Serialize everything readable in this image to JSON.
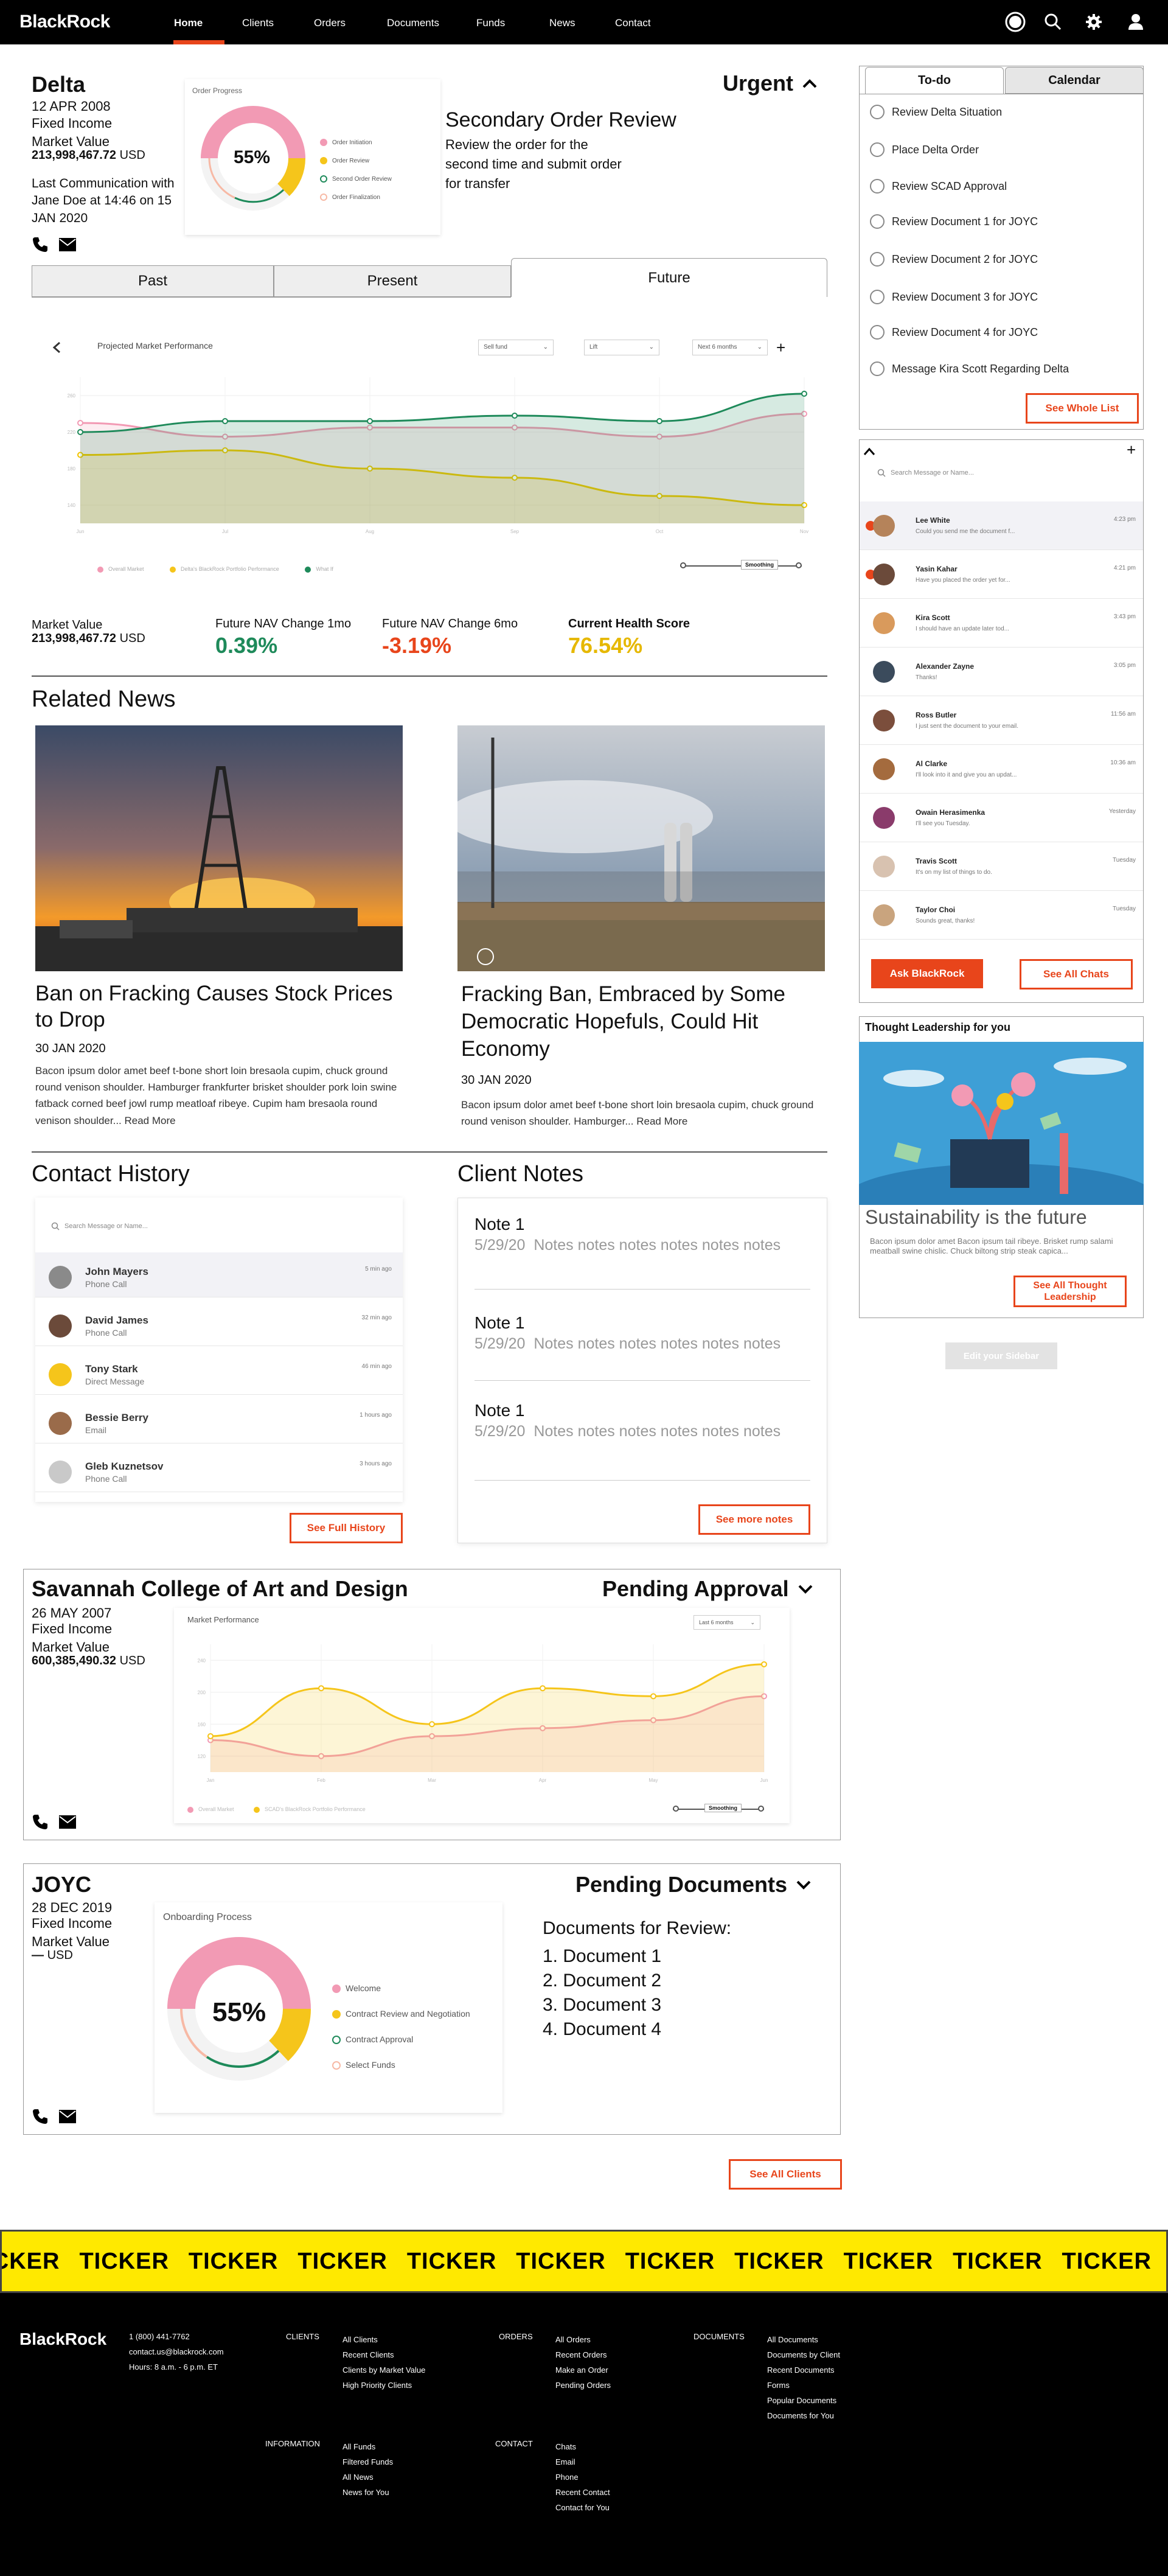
{
  "nav": {
    "logo": "BlackRock",
    "links": [
      "Home",
      "Clients",
      "Orders",
      "Documents",
      "Funds",
      "News",
      "Contact"
    ],
    "active": "Home",
    "icons": [
      "profile-ring-icon",
      "search-icon",
      "gear-icon",
      "user-icon"
    ]
  },
  "delta": {
    "name": "Delta",
    "date": "12 APR 2008",
    "type": "Fixed Income",
    "mv_label": "Market Value",
    "mv": "213,998,467.72",
    "currency": "USD",
    "last_comm": "Last Communication with Jane Doe at 14:46 on 15 JAN 2020",
    "priority": "Urgent",
    "progress_title": "Order Progress",
    "progress_pct": "55%",
    "progress_value": 0.55,
    "progress_legend": [
      "Order Initiation",
      "Order Review",
      "Second Order Review",
      "Order Finalization"
    ],
    "review_title": "Secondary Order Review",
    "review_text": "Review the order for the second time and submit order for transfer",
    "tabs": [
      "Past",
      "Present",
      "Future"
    ],
    "active_tab": "Future",
    "chart_title": "Projected Market Performance",
    "selects": [
      "Sell fund",
      "Lift",
      "Next 6 months"
    ],
    "smoothing": "Smoothing",
    "stats": {
      "mv_label": "Market Value",
      "mv": "213,998,467.72",
      "currency": "USD",
      "c1_label": "Future NAV Change 1mo",
      "c1": "0.39%",
      "c2_label": "Future NAV Change 6mo",
      "c2": "-3.19%",
      "c3_label": "Current Health Score",
      "c3": "76.54%"
    }
  },
  "todo": {
    "tabs": [
      "To-do",
      "Calendar"
    ],
    "items": [
      "Review Delta Situation",
      "Place Delta Order",
      "Review SCAD Approval",
      "Review Document 1 for JOYC",
      "Review Document 2 for JOYC",
      "Review Document 3 for JOYC",
      "Review Document 4 for JOYC",
      "Message Kira Scott Regarding Delta"
    ],
    "button": "See Whole List"
  },
  "chats": {
    "search_placeholder": "Search Message or Name...",
    "items": [
      {
        "name": "Lee White",
        "preview": "Could you send me the document f...",
        "time": "4:23 pm"
      },
      {
        "name": "Yasin Kahar",
        "preview": "Have you placed the order yet for...",
        "time": "4:21 pm"
      },
      {
        "name": "Kira Scott",
        "preview": "I should have an update later tod...",
        "time": "3:43 pm"
      },
      {
        "name": "Alexander Zayne",
        "preview": "Thanks!",
        "time": "3:05 pm"
      },
      {
        "name": "Ross Butler",
        "preview": "I just sent the document to your email.",
        "time": "11:56 am"
      },
      {
        "name": "Al Clarke",
        "preview": "I'll look into it and give you an updat...",
        "time": "10:36 am"
      },
      {
        "name": "Owain Herasimenka",
        "preview": "I'll see you Tuesday.",
        "time": "Yesterday"
      },
      {
        "name": "Travis Scott",
        "preview": "It's on my list of things to do.",
        "time": "Tuesday"
      },
      {
        "name": "Taylor Choi",
        "preview": "Sounds great, thanks!",
        "time": "Tuesday"
      }
    ],
    "ask_button": "Ask BlackRock",
    "see_all_button": "See All Chats"
  },
  "thought": {
    "header": "Thought Leadership for you",
    "title": "Sustainability is the future",
    "text": "Bacon ipsum dolor amet Bacon ipsum tail ribeye. Brisket rump salami meatball swine chislic. Chuck biltong strip steak capica...",
    "button": "See All Thought Leadership",
    "edit_button": "Edit your Sidebar"
  },
  "news": {
    "title": "Related News",
    "items": [
      {
        "headline": "Ban on Fracking Causes Stock Prices to Drop",
        "date": "30 JAN 2020",
        "body": "Bacon ipsum dolor amet beef t-bone short loin bresaola cupim, chuck ground round venison shoulder. Hamburger frankfurter brisket shoulder pork loin swine fatback corned beef jowl rump meatloaf ribeye. Cupim ham bresaola round venison shoulder... Read More"
      },
      {
        "headline": "Fracking Ban, Embraced by Some Democratic Hopefuls, Could Hit Economy",
        "date": "30 JAN 2020",
        "body": "Bacon ipsum dolor amet beef t-bone short loin bresaola cupim, chuck ground round venison shoulder. Hamburger... Read More"
      }
    ]
  },
  "contact_history": {
    "title": "Contact History",
    "search_placeholder": "Search Message or Name...",
    "items": [
      {
        "name": "John Mayers",
        "type": "Phone Call",
        "time": "5 min ago"
      },
      {
        "name": "David James",
        "type": "Phone Call",
        "time": "32 min ago"
      },
      {
        "name": "Tony Stark",
        "type": "Direct Message",
        "time": "46 min ago"
      },
      {
        "name": "Bessie Berry",
        "type": "Email",
        "time": "1 hours ago"
      },
      {
        "name": "Gleb Kuznetsov",
        "type": "Phone Call",
        "time": "3 hours ago"
      }
    ],
    "button": "See Full History"
  },
  "client_notes": {
    "title": "Client Notes",
    "items": [
      {
        "title": "Note 1",
        "date": "5/29/20",
        "text": "Notes notes notes notes notes notes"
      },
      {
        "title": "Note 1",
        "date": "5/29/20",
        "text": "Notes notes notes notes notes notes"
      },
      {
        "title": "Note 1",
        "date": "5/29/20",
        "text": "Notes notes notes notes notes notes"
      }
    ],
    "button": "See more notes"
  },
  "scad": {
    "name": "Savannah College of Art and Design",
    "status": "Pending Approval",
    "date": "26 MAY 2007",
    "type": "Fixed Income",
    "mv_label": "Market Value",
    "mv": "600,385,490.32",
    "currency": "USD",
    "chart_title": "Market Performance",
    "select": "Last 6 months",
    "smoothing": "Smoothing"
  },
  "joyc": {
    "name": "JOYC",
    "status": "Pending Documents",
    "date": "28 DEC 2019",
    "type": "Fixed Income",
    "mv_label": "Market Value",
    "mv": "—",
    "currency": "USD",
    "process_title": "Onboarding Process",
    "pct": "55%",
    "pct_value": 0.55,
    "legend": [
      "Welcome",
      "Contract Review and Negotiation",
      "Contract Approval",
      "Select Funds"
    ],
    "docs_title": "Documents for Review:",
    "docs": [
      "1. Document 1",
      "2. Document 2",
      "3. Document 3",
      "4. Document 4"
    ]
  },
  "see_all_clients": "See All Clients",
  "ticker_word": "TICKER",
  "footer": {
    "logo": "BlackRock",
    "phone": "1 (800) 441-7762",
    "email": "contact.us@blackrock.com",
    "hours": "Hours: 8 a.m. - 6 p.m. ET",
    "clients_head": "CLIENTS",
    "clients": [
      "All Clients",
      "Recent Clients",
      "Clients by Market Value",
      "High Priority Clients"
    ],
    "orders_head": "ORDERS",
    "orders": [
      "All Orders",
      "Recent Orders",
      "Make an Order",
      "Pending Orders"
    ],
    "docs_head": "DOCUMENTS",
    "docs": [
      "All Documents",
      "Documents by Client",
      "Recent Documents",
      "Forms",
      "Popular Documents",
      "Documents for You"
    ],
    "info_head": "INFORMATION",
    "info": [
      "All Funds",
      "Filtered Funds",
      "All News",
      "News for You"
    ],
    "contact_head": "CONTACT",
    "contact": [
      "Chats",
      "Email",
      "Phone",
      "Recent Contact",
      "Contact for You"
    ]
  },
  "colors": {
    "accent": "#e8451b",
    "green": "#1e8a5a",
    "yellow": "#f2c400",
    "pink": "#f29ab4"
  },
  "chart_data": [
    {
      "type": "line",
      "title": "Projected Market Performance",
      "x": [
        "Jun",
        "Jul",
        "Aug",
        "Sep",
        "Oct",
        "Nov"
      ],
      "series": [
        {
          "name": "Overall Market",
          "values": [
            230,
            215,
            225,
            225,
            215,
            240
          ]
        },
        {
          "name": "Delta's BlackRock Portfolio Performance",
          "values": [
            195,
            200,
            180,
            170,
            150,
            140
          ]
        },
        {
          "name": "What If",
          "values": [
            220,
            232,
            232,
            238,
            232,
            262
          ]
        }
      ]
    },
    {
      "type": "area",
      "title": "Market Performance",
      "x": [
        "Jan",
        "Feb",
        "Mar",
        "Apr",
        "May",
        "Jun"
      ],
      "series": [
        {
          "name": "Overall Market",
          "values": [
            140,
            120,
            145,
            155,
            165,
            195
          ]
        },
        {
          "name": "SCAD's BlackRock Portfolio Performance",
          "values": [
            145,
            205,
            160,
            205,
            195,
            235
          ]
        }
      ]
    }
  ]
}
